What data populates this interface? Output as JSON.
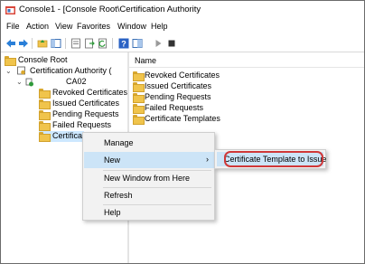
{
  "window": {
    "title": "Console1 - [Console Root\\Certification Authority",
    "icon": "mmc-console-icon"
  },
  "menu": [
    "File",
    "Action",
    "View",
    "Favorites",
    "Window",
    "Help"
  ],
  "toolbar": {
    "icons": [
      "back-arrow-icon",
      "forward-arrow-icon",
      "up-folder-icon",
      "show-hide-tree-icon",
      "properties-icon",
      "export-list-icon",
      "refresh-icon",
      "help-icon",
      "console-view-icon",
      "start-service-icon",
      "stop-service-icon"
    ]
  },
  "tree": {
    "root": "Console Root",
    "ca_label": "Certification Authority (",
    "ca_name": "CA02",
    "children": [
      "Revoked Certificates",
      "Issued Certificates",
      "Pending Requests",
      "Failed Requests",
      "Certifica"
    ]
  },
  "right_pane": {
    "column_name": "Name",
    "items": [
      "Revoked Certificates",
      "Issued Certificates",
      "Pending Requests",
      "Failed Requests",
      "Certificate Templates"
    ]
  },
  "context_menu": {
    "manage": "Manage",
    "new": "New",
    "new_window": "New Window from Here",
    "refresh": "Refresh",
    "help": "Help",
    "arrow": "›"
  },
  "submenu": {
    "item": "Certificate Template to Issue"
  },
  "colors": {
    "highlight": "#cce4f7",
    "selection": "#cde8ff",
    "ring": "#d03838",
    "folder": "#f0c44c"
  }
}
